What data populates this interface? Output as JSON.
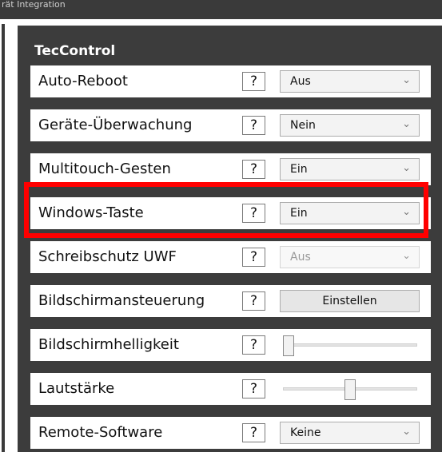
{
  "window": {
    "title_fragment": "rät Integration"
  },
  "panel": {
    "title": "TecControl",
    "colors": {
      "panel_bg": "#3c3c3c",
      "highlight": "#ff0000"
    },
    "rows": [
      {
        "label": "Auto-Reboot",
        "help": "?",
        "control": "select",
        "value": "Aus"
      },
      {
        "label": "Geräte-Überwachung",
        "help": "?",
        "control": "select",
        "value": "Nein"
      },
      {
        "label": "Multitouch-Gesten",
        "help": "?",
        "control": "select",
        "value": "Ein"
      },
      {
        "label": "Windows-Taste",
        "help": "?",
        "control": "select",
        "value": "Ein"
      },
      {
        "label": "Schreibschutz UWF",
        "help": "?",
        "control": "select",
        "value": "Aus",
        "disabled": true
      },
      {
        "label": "Bildschirmansteuerung",
        "help": "?",
        "control": "button",
        "value": "Einstellen"
      },
      {
        "label": "Bildschirmhelligkeit",
        "help": "?",
        "control": "slider",
        "level": 0.0
      },
      {
        "label": "Lautstärke",
        "help": "?",
        "control": "slider",
        "level": 0.5
      },
      {
        "label": "Remote-Software",
        "help": "?",
        "control": "select",
        "value": "Keine"
      }
    ]
  },
  "icons": {
    "dropdown": "chevron-down-icon",
    "help": "question-mark"
  }
}
